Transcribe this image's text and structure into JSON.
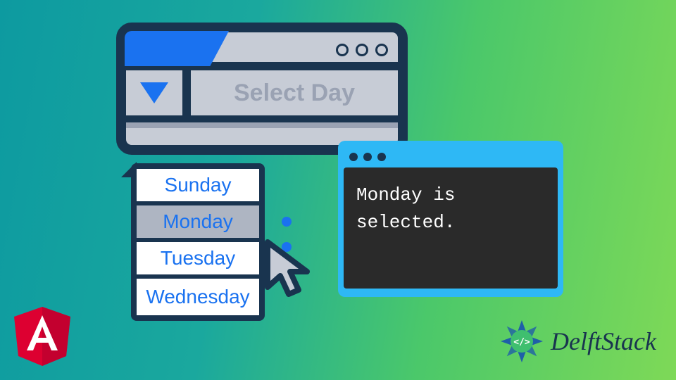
{
  "select": {
    "placeholder": "Select Day",
    "options": [
      "Sunday",
      "Monday",
      "Tuesday",
      "Wednesday"
    ],
    "selected_index": 1
  },
  "terminal": {
    "output": "Monday is selected."
  },
  "brand": {
    "name": "DelftStack"
  },
  "icons": {
    "angular": "angular-logo",
    "dropdown": "chevron-down-icon",
    "cursor": "cursor-icon"
  },
  "colors": {
    "frame": "#19344f",
    "accent": "#1a72f0",
    "terminal_frame": "#2eb8f5",
    "terminal_bg": "#2a2a2a"
  }
}
